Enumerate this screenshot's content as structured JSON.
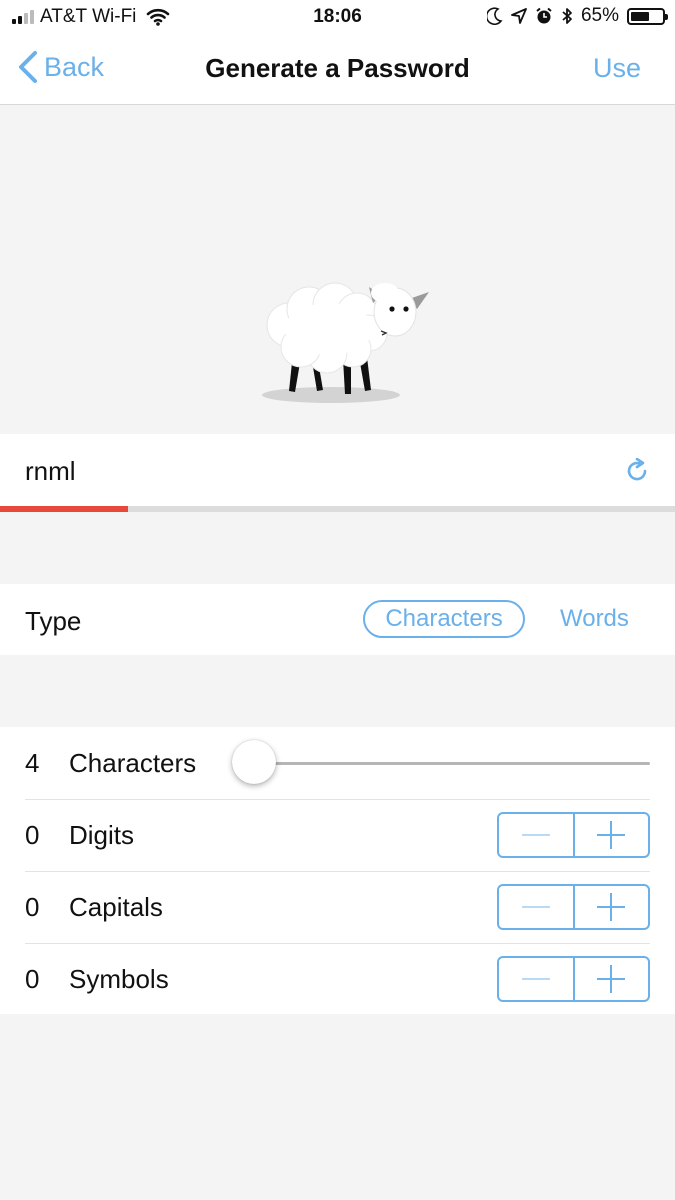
{
  "status_bar": {
    "carrier": "AT&T Wi-Fi",
    "time": "18:06",
    "battery_percent": "65%",
    "battery_level": 0.65,
    "icons": [
      "signal-icon",
      "wifi-icon",
      "moon-icon",
      "location-arrow-icon",
      "alarm-icon",
      "bluetooth-icon",
      "battery-icon"
    ]
  },
  "nav": {
    "back_label": "Back",
    "title": "Generate a Password",
    "use_label": "Use"
  },
  "password": {
    "value": "rnml",
    "strength": 0.19,
    "strength_color": "#e8483a"
  },
  "type": {
    "label": "Type",
    "options": [
      "Characters",
      "Words"
    ],
    "selected": "Characters"
  },
  "options": {
    "characters": {
      "count": "4",
      "label": "Characters",
      "slider_level": 0
    },
    "digits": {
      "count": "0",
      "label": "Digits"
    },
    "capitals": {
      "count": "0",
      "label": "Capitals"
    },
    "symbols": {
      "count": "0",
      "label": "Symbols"
    }
  },
  "colors": {
    "accent": "#6ab0ea",
    "background": "#f4f4f4",
    "strength_weak": "#e8483a"
  }
}
